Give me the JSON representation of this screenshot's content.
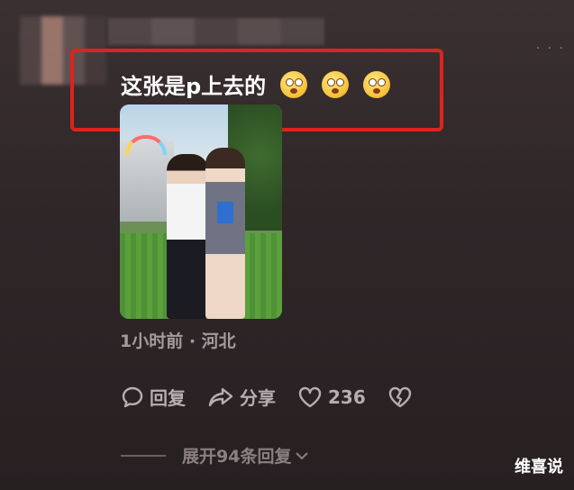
{
  "comment": {
    "text": "这张是p上去的",
    "emojis": [
      "surprised-face-emoji",
      "surprised-face-emoji",
      "surprised-face-emoji"
    ]
  },
  "meta": {
    "time_location": "1小时前 · 河北"
  },
  "actions": {
    "reply_label": "回复",
    "share_label": "分享",
    "like_count": "236"
  },
  "expand": {
    "label": "展开94条回复"
  },
  "watermark": "维喜说",
  "colors": {
    "highlight": "#e0231a",
    "secondary_text": "#a59b9c"
  }
}
